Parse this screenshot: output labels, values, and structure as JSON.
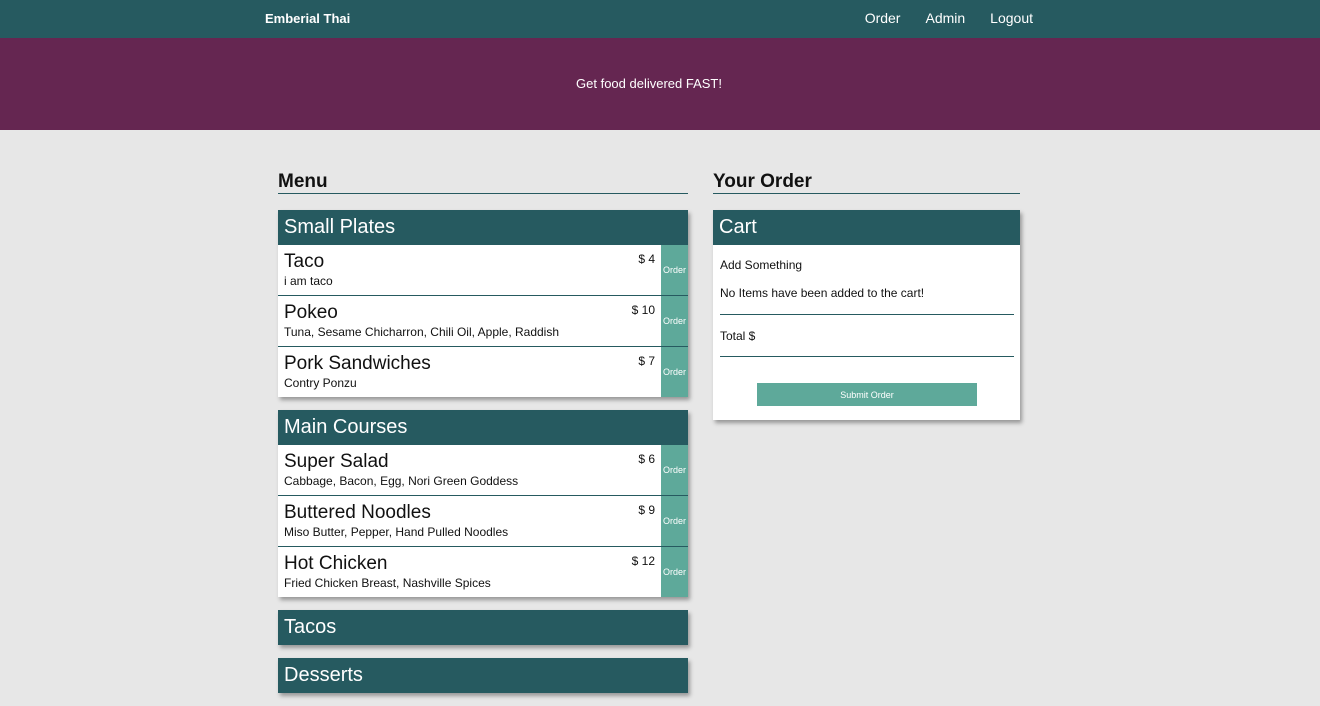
{
  "nav": {
    "brand": "Emberial Thai",
    "links": [
      "Order",
      "Admin",
      "Logout"
    ]
  },
  "hero": {
    "tagline": "Get food delivered FAST!"
  },
  "menu": {
    "title": "Menu",
    "order_label": "Order",
    "categories": [
      {
        "name": "Small Plates",
        "items": [
          {
            "name": "Taco",
            "desc": "i am taco",
            "price": "$ 4"
          },
          {
            "name": "Pokeo",
            "desc": "Tuna, Sesame Chicharron, Chili Oil, Apple, Raddish",
            "price": "$ 10"
          },
          {
            "name": "Pork Sandwiches",
            "desc": "Contry Ponzu",
            "price": "$ 7"
          }
        ]
      },
      {
        "name": "Main Courses",
        "items": [
          {
            "name": "Super Salad",
            "desc": "Cabbage, Bacon, Egg, Nori Green Goddess",
            "price": "$ 6"
          },
          {
            "name": "Buttered Noodles",
            "desc": "Miso Butter, Pepper, Hand Pulled Noodles",
            "price": "$ 9"
          },
          {
            "name": "Hot Chicken",
            "desc": "Fried Chicken Breast, Nashville Spices",
            "price": "$ 12"
          }
        ]
      },
      {
        "name": "Tacos",
        "items": []
      },
      {
        "name": "Desserts",
        "items": []
      }
    ]
  },
  "order": {
    "title": "Your Order",
    "cart_title": "Cart",
    "add_prompt": "Add Something",
    "empty_msg": "No Items have been added to the cart!",
    "total_label": "Total $",
    "submit_label": "Submit Order"
  },
  "colors": {
    "nav": "#265a60",
    "hero": "#652651",
    "accent": "#5ea99a",
    "background": "#e7e7e7"
  }
}
